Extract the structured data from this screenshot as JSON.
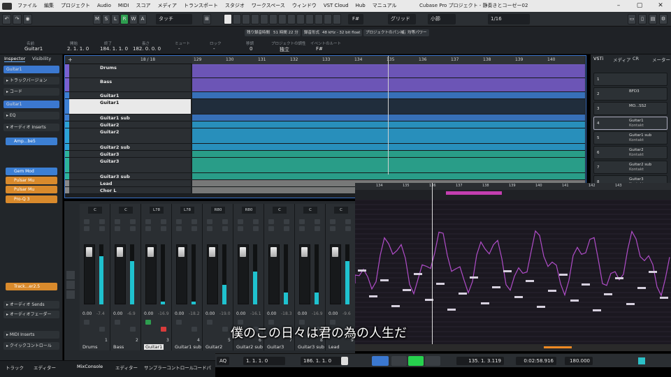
{
  "menubar": {
    "items": [
      "ファイル",
      "編集",
      "プロジェクト",
      "Audio",
      "MIDI",
      "スコア",
      "メディア",
      "トランスポート",
      "スタジオ",
      "ワークスペース",
      "ウィンドウ",
      "VST Cloud",
      "Hub",
      "マニュアル"
    ],
    "title": "Cubase Pro プロジェクト - 静奏きとコーゼー02"
  },
  "toolbar": {
    "mode_buttons": [
      "M",
      "S",
      "L",
      "R",
      "W",
      "A"
    ],
    "automation_mode": "タッチ",
    "snap_type": "グリッド",
    "grid": "小節",
    "quantize": "1/16",
    "key": "F#"
  },
  "infoline": {
    "labels": {
      "name": "名前",
      "start": "開始",
      "end": "終了",
      "length": "長さ",
      "mute": "ミュート",
      "lock": "ロック",
      "scale": "移調",
      "independent": "プロジェクトの調性",
      "event_root": "イベントのルート"
    },
    "values": {
      "name": "Guitar1",
      "start": "2. 1. 1. 0",
      "end": "184. 1. 1. 0",
      "length": "182. 0. 0. 0",
      "mute": "-",
      "lock": "-",
      "transpose": "0",
      "mode": "独立",
      "root": "F#"
    },
    "status": {
      "rec_time": "残り録音時間",
      "rec_time_val": "51 時間 22 分",
      "rec_format": "録音形式",
      "format_val": "48 kHz - 32 bit float",
      "pan": "プロジェクトのパン補正",
      "power": "均等パワー"
    }
  },
  "inspector": {
    "tabs": [
      "Inspector",
      "Visibility"
    ],
    "track_name": "Guitar1",
    "sections": [
      "トラックバージョン",
      "コード",
      "EQ",
      "オーディオ Inserts",
      "オーディオ Sends",
      "オーディオフェーダー",
      "MIDI Inserts",
      "クイックコントロール"
    ],
    "inserts": [
      "Amp...be5",
      "Gem Mod",
      "Pulsar Mu",
      "Pulsar Mu",
      "Pro-Q 3",
      "Track...er2.5"
    ],
    "chain_name": "Guitar1"
  },
  "project": {
    "track_count": "18 / 18",
    "ruler": [
      "129",
      "130",
      "131",
      "132",
      "133",
      "134",
      "135",
      "136",
      "137",
      "138",
      "139",
      "140"
    ],
    "tracks": [
      {
        "name": "Drums",
        "color": "#7a5fd0"
      },
      {
        "name": "Bass",
        "color": "#7a5fd0"
      },
      {
        "name": "Guitar1",
        "color": "#3c7fd3"
      },
      {
        "name": "Guitar1",
        "color": "#3c7fd3"
      },
      {
        "name": "Guitar1 sub",
        "color": "#3c7fd3"
      },
      {
        "name": "Guitar2",
        "color": "#2ba3d6"
      },
      {
        "name": "Guitar2",
        "color": "#2ba3d6"
      },
      {
        "name": "Guitar2 sub",
        "color": "#2ba3d6"
      },
      {
        "name": "Guitar3",
        "color": "#2cb39a"
      },
      {
        "name": "Guitar3",
        "color": "#2cb39a"
      },
      {
        "name": "Guitar3 sub",
        "color": "#2cb39a"
      },
      {
        "name": "Lead",
        "color": "#888"
      },
      {
        "name": "Chor L",
        "color": "#888"
      }
    ]
  },
  "vsti": {
    "tabs": [
      "VSTi",
      "メディア",
      "CR",
      "メーター"
    ],
    "instruments": [
      {
        "n": "1",
        "name": "",
        "sub": ""
      },
      {
        "n": "2",
        "name": "BFD3",
        "sub": ""
      },
      {
        "n": "3",
        "name": "MO...SS2",
        "sub": ""
      },
      {
        "n": "4",
        "name": "Guitar1",
        "sub": "Kontakt"
      },
      {
        "n": "5",
        "name": "Guitar1 sub",
        "sub": "Kontakt"
      },
      {
        "n": "6",
        "name": "Guitar2",
        "sub": "Kontakt"
      },
      {
        "n": "7",
        "name": "Guitar2 sub",
        "sub": "Kontakt"
      },
      {
        "n": "8",
        "name": "Guitar3",
        "sub": "Kontakt"
      }
    ]
  },
  "mixer": {
    "channels": [
      {
        "name": "Drums",
        "pan": "C",
        "gain": "0.00",
        "peak": "-7.4",
        "num": "1"
      },
      {
        "name": "Bass",
        "pan": "C",
        "gain": "0.00",
        "peak": "-6.9",
        "num": "2"
      },
      {
        "name": "Guitar1",
        "pan": "L78",
        "gain": "0.00",
        "peak": "-16.9",
        "num": "3"
      },
      {
        "name": "Guitar1 sub",
        "pan": "L78",
        "gain": "0.00",
        "peak": "-18.2",
        "num": "4"
      },
      {
        "name": "Guitar2",
        "pan": "R80",
        "gain": "0.00",
        "peak": "-19.0",
        "num": "5"
      },
      {
        "name": "Guitar2 sub",
        "pan": "R80",
        "gain": "0.00",
        "peak": "-16.1",
        "num": "6"
      },
      {
        "name": "Guitar3",
        "pan": "C",
        "gain": "0.00",
        "peak": "-18.3",
        "num": "7"
      },
      {
        "name": "Guitar3 sub",
        "pan": "C",
        "gain": "0.00",
        "peak": "-16.9",
        "num": "8"
      },
      {
        "name": "Lead",
        "pan": "C",
        "gain": "0.00",
        "peak": "-9.6",
        "num": "9"
      }
    ]
  },
  "keyeditor": {
    "ruler": [
      "134",
      "135",
      "136",
      "137",
      "138",
      "139",
      "140",
      "141",
      "142",
      "143"
    ]
  },
  "subtitle": "僕のこの日々は君の為の人生だ",
  "transport": {
    "mode": "AQ",
    "left": "1. 1. 1. 0",
    "right": "186. 1. 1. 0",
    "position": "135. 1. 3.119",
    "time": "0:02:58.916",
    "tempo": "180.000"
  },
  "bottom": {
    "tabs": [
      "トラック",
      "エディター"
    ],
    "lower_tabs": [
      "MixConsole",
      "エディター",
      "サンプラーコントロール",
      "コードパ"
    ]
  }
}
